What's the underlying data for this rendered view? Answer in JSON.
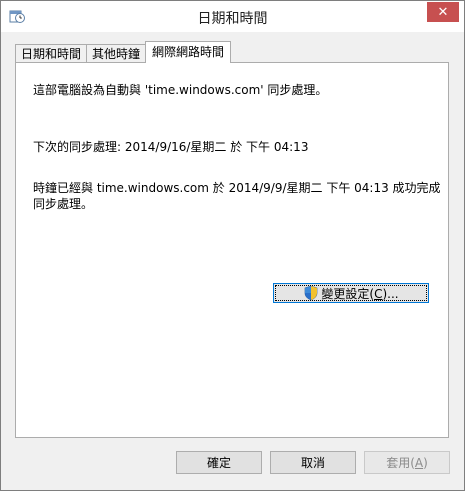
{
  "window": {
    "title": "日期和時間",
    "close_glyph": "✕"
  },
  "tabs": [
    {
      "label": "日期和時間",
      "active": false
    },
    {
      "label": "其他時鐘",
      "active": false
    },
    {
      "label": "網際網路時間",
      "active": true
    }
  ],
  "panel": {
    "sync_info": "這部電腦設為自動與 'time.windows.com' 同步處理。",
    "next_sync": "下次的同步處理: 2014/9/16/星期二 於 下午 04:13",
    "last_sync_line1": "時鐘已經與 time.windows.com 於 2014/9/9/星期二 下午 04:13 成功完成",
    "last_sync_line2": "同步處理。",
    "change_settings": {
      "text": "變更設定(",
      "accel": "C",
      "suffix": ")..."
    }
  },
  "buttons": {
    "ok": "確定",
    "cancel": "取消",
    "apply_text": "套用(",
    "apply_accel": "A",
    "apply_suffix": ")"
  },
  "colors": {
    "close_bg": "#c75050",
    "focus_border": "#0078d7"
  },
  "icons": {
    "app": "clock-calendar-icon",
    "shield": "uac-shield-icon"
  }
}
